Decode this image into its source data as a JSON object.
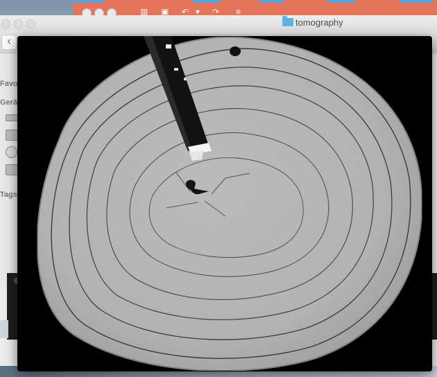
{
  "finder": {
    "title": "tomography",
    "sidebar": {
      "favorites_label": "Favo",
      "devices_label": "Gerä",
      "tags_label": "Tags"
    },
    "back_glyph": "‹"
  },
  "icons": {
    "folder": "folder-icon",
    "back": "chevron-left-icon",
    "sidebar_devices": [
      "laptop-icon",
      "disk-icon",
      "optical-disc-icon",
      "external-drive-icon"
    ]
  },
  "colors": {
    "app_strip": "#e5745a",
    "tab_accent": "#57a3de",
    "folder": "#61b1ea",
    "scan_background": "#000000",
    "specimen": "#c4c4c4"
  },
  "viewer": {
    "image_description_kind": "tomography-slice"
  }
}
